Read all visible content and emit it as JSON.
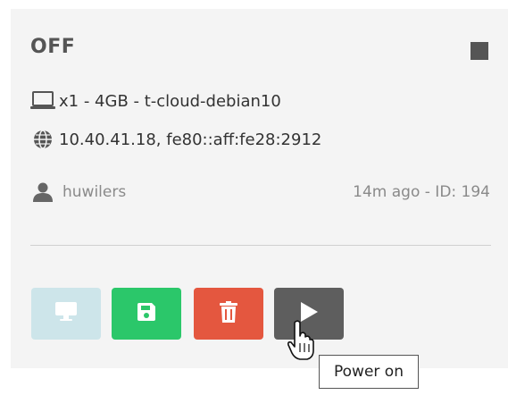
{
  "vm_card": {
    "status": "OFF",
    "spec_line": "x1 - 4GB - t-cloud-debian10",
    "addresses": "10.40.41.18, fe80::aff:fe28:2912",
    "owner": "huwilers",
    "meta": "14m ago - ID: 194"
  },
  "icons": {
    "stop": "stop-square-icon",
    "spec": "laptop-icon",
    "network": "globe-icon",
    "owner": "user-icon",
    "console": "monitor-icon",
    "save": "floppy-disk-icon",
    "delete": "trash-icon",
    "power": "play-icon",
    "cursor": "hand-pointer-icon"
  },
  "tooltip": {
    "text": "Power on"
  },
  "colors": {
    "card_bg": "#f4f4f4",
    "status_text": "#555555",
    "console_button": "#cde5ea",
    "save_button": "#2bc76a",
    "delete_button": "#e4573f",
    "power_button": "#5e5e5e"
  }
}
